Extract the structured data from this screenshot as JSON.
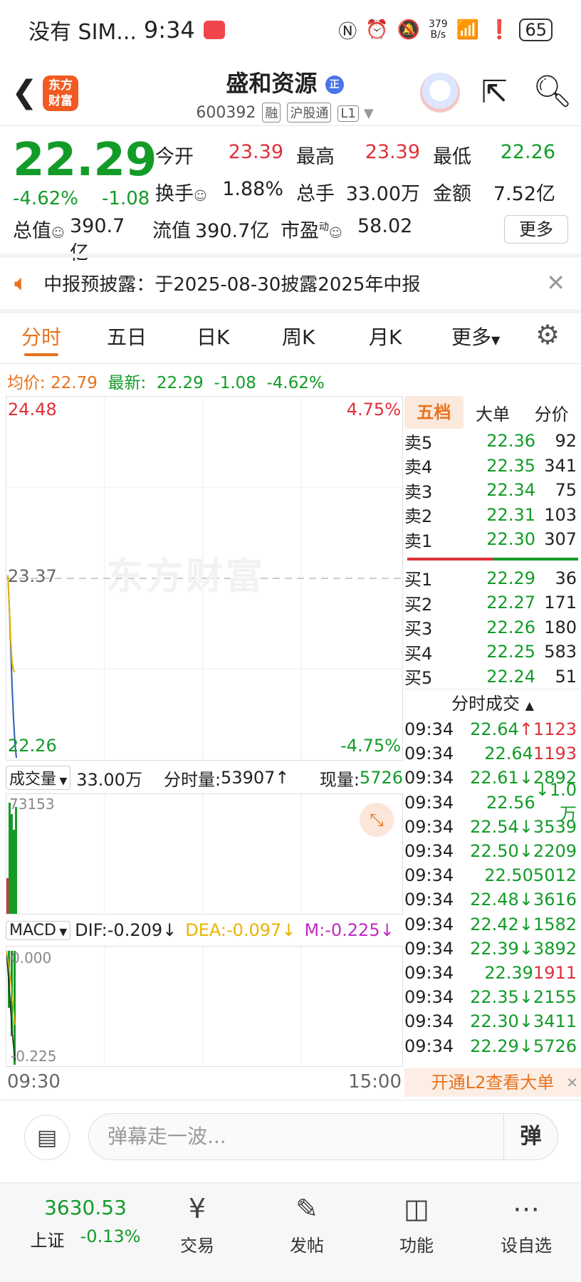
{
  "status": {
    "carrier": "没有 SIM...",
    "time": "9:34",
    "net_speed_value": "379",
    "net_speed_unit": "B/s",
    "battery": "65",
    "icons": [
      "nfc-icon",
      "alarm-icon",
      "mute-icon",
      "wifi-icon",
      "alert-icon"
    ]
  },
  "header": {
    "logo_line1": "东方",
    "logo_line2": "财富",
    "title": "盛和资源",
    "title_badge": "正",
    "code": "600392",
    "tags": [
      "融",
      "沪股通",
      "L1"
    ]
  },
  "quote": {
    "price": "22.29",
    "change_pct": "-4.62%",
    "change": "-1.08",
    "rows": [
      [
        {
          "label": "今开",
          "value": "23.39",
          "color": "red"
        },
        {
          "label": "最高",
          "value": "23.39",
          "color": "red"
        },
        {
          "label": "最低",
          "value": "22.26",
          "color": "green"
        }
      ],
      [
        {
          "label": "换手",
          "value": "1.88%",
          "color": "dark"
        },
        {
          "label": "总手",
          "value": "33.00万",
          "color": "dark"
        },
        {
          "label": "金额",
          "value": "7.52亿",
          "color": "dark"
        }
      ]
    ],
    "row3": [
      {
        "label": "总值",
        "value": "390.7亿"
      },
      {
        "label": "流值",
        "value": "390.7亿"
      },
      {
        "label": "市盈",
        "label_sup": "动",
        "value": "58.02"
      }
    ],
    "more": "更多"
  },
  "notice": {
    "text": "中报预披露：于2025-08-30披露2025年中报"
  },
  "tabs": [
    "分时",
    "五日",
    "日K",
    "周K",
    "月K",
    "更多"
  ],
  "avg_line": {
    "avg_label": "均价:",
    "avg_value": "22.79",
    "latest_label": "最新:",
    "latest_value": "22.29",
    "change": "-1.08",
    "change_pct": "-4.62%"
  },
  "chart_data": {
    "type": "line",
    "title": "",
    "ylim": [
      22.26,
      24.48
    ],
    "y_top_label": "24.48",
    "y_bottom_label": "22.26",
    "y_mid_label": "23.37",
    "pct_top_label": "4.75%",
    "pct_bottom_label": "-4.75%",
    "x_start": "09:30",
    "x_end": "15:00",
    "series": [
      {
        "values": [
          23.39,
          23.2,
          22.95,
          22.7,
          22.5,
          22.35,
          22.26
        ]
      },
      {
        "values": [
          23.39,
          23.2,
          23.0,
          22.85,
          22.8,
          22.79
        ]
      }
    ]
  },
  "volume": {
    "dropdown": "成交量",
    "total": "33.00万",
    "tick_label": "分时量:",
    "tick_value": "53907",
    "now_label": "现量:",
    "now_value": "5726",
    "max_label": "73153"
  },
  "macd": {
    "dropdown": "MACD",
    "dif": "DIF:-0.209",
    "dea": "DEA:-0.097",
    "m": "M:-0.225",
    "top_label": "0.000",
    "bottom_label": "-0.225"
  },
  "book": {
    "tabs": [
      "五档",
      "大单",
      "分价"
    ],
    "asks": [
      {
        "label": "卖5",
        "price": "22.36",
        "vol": "92"
      },
      {
        "label": "卖4",
        "price": "22.35",
        "vol": "341"
      },
      {
        "label": "卖3",
        "price": "22.34",
        "vol": "75"
      },
      {
        "label": "卖2",
        "price": "22.31",
        "vol": "103"
      },
      {
        "label": "卖1",
        "price": "22.30",
        "vol": "307"
      }
    ],
    "bids": [
      {
        "label": "买1",
        "price": "22.29",
        "vol": "36"
      },
      {
        "label": "买2",
        "price": "22.27",
        "vol": "171"
      },
      {
        "label": "买3",
        "price": "22.26",
        "vol": "180"
      },
      {
        "label": "买4",
        "price": "22.25",
        "vol": "583"
      },
      {
        "label": "买5",
        "price": "22.24",
        "vol": "51"
      }
    ],
    "ticks_title": "分时成交",
    "ticks": [
      {
        "time": "09:34",
        "price": "22.64",
        "arrow": "↑",
        "vol": "1123",
        "color": "red"
      },
      {
        "time": "09:34",
        "price": "22.64",
        "arrow": "",
        "vol": "1193",
        "color": "red"
      },
      {
        "time": "09:34",
        "price": "22.61",
        "arrow": "↓",
        "vol": "2892",
        "color": "green"
      },
      {
        "time": "09:34",
        "price": "22.56",
        "arrow": "↓",
        "vol": "1.0万",
        "color": "green"
      },
      {
        "time": "09:34",
        "price": "22.54",
        "arrow": "↓",
        "vol": "3539",
        "color": "green"
      },
      {
        "time": "09:34",
        "price": "22.50",
        "arrow": "↓",
        "vol": "2209",
        "color": "green"
      },
      {
        "time": "09:34",
        "price": "22.50",
        "arrow": "",
        "vol": "5012",
        "color": "green"
      },
      {
        "time": "09:34",
        "price": "22.48",
        "arrow": "↓",
        "vol": "3616",
        "color": "green"
      },
      {
        "time": "09:34",
        "price": "22.42",
        "arrow": "↓",
        "vol": "1582",
        "color": "green"
      },
      {
        "time": "09:34",
        "price": "22.39",
        "arrow": "↓",
        "vol": "3892",
        "color": "green"
      },
      {
        "time": "09:34",
        "price": "22.39",
        "arrow": "",
        "vol": "1911",
        "color": "red"
      },
      {
        "time": "09:34",
        "price": "22.35",
        "arrow": "↓",
        "vol": "2155",
        "color": "green"
      },
      {
        "time": "09:34",
        "price": "22.30",
        "arrow": "↓",
        "vol": "3411",
        "color": "green"
      },
      {
        "time": "09:34",
        "price": "22.29",
        "arrow": "↓",
        "vol": "5726",
        "color": "green"
      }
    ],
    "l2_text": "开通L2查看大单"
  },
  "comment": {
    "placeholder": "弹幕走一波...",
    "dan_label": "弹"
  },
  "bottom": {
    "index_value": "3630.53",
    "index_name": "上证",
    "index_change": "-0.13%",
    "nav": [
      "交易",
      "发帖",
      "功能",
      "设自选"
    ]
  }
}
